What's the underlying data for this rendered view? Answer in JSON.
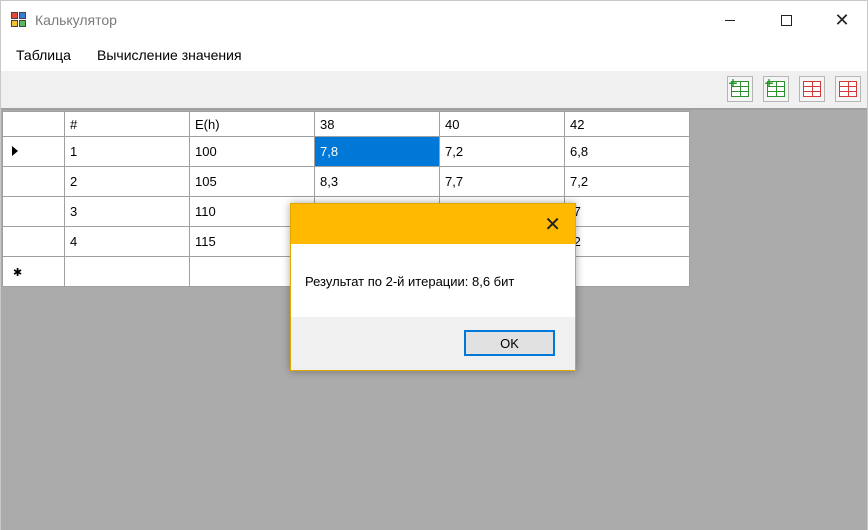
{
  "window": {
    "title": "Калькулятор"
  },
  "menu": {
    "items": [
      "Таблица",
      "Вычисление значения"
    ]
  },
  "grid": {
    "columns": [
      "#",
      "E(h)",
      "38",
      "40",
      "42"
    ],
    "rows": [
      [
        "1",
        "100",
        "7,8",
        "7,2",
        "6,8"
      ],
      [
        "2",
        "105",
        "8,3",
        "7,7",
        "7,2"
      ],
      [
        "3",
        "110",
        "",
        "",
        ",7"
      ],
      [
        "4",
        "115",
        "",
        "",
        ",2"
      ]
    ],
    "selected_cell": "7,8"
  },
  "dialog": {
    "message": "Результат по 2-й итерации: 8,6 бит",
    "ok_label": "OK"
  },
  "colors": {
    "selection": "#0078d7",
    "dialog_title": "#ffb900",
    "grid_background": "#ababab"
  },
  "icons": {
    "toolbar": [
      "add-column-icon",
      "add-row-icon",
      "delete-column-icon",
      "delete-row-icon"
    ]
  }
}
